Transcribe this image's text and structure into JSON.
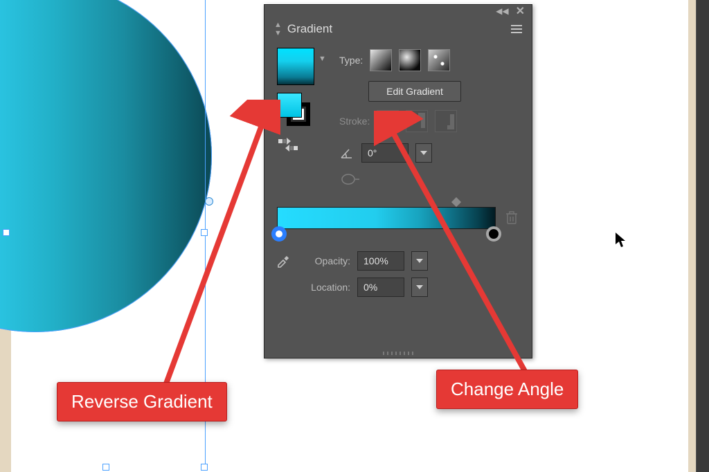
{
  "panel": {
    "title": "Gradient",
    "type_label": "Type:",
    "edit_button": "Edit Gradient",
    "stroke_label": "Stroke:",
    "angle_value": "0°",
    "opacity_label": "Opacity:",
    "opacity_value": "100%",
    "location_label": "Location:",
    "location_value": "0%"
  },
  "callouts": {
    "reverse": "Reverse Gradient",
    "angle": "Change Angle"
  }
}
